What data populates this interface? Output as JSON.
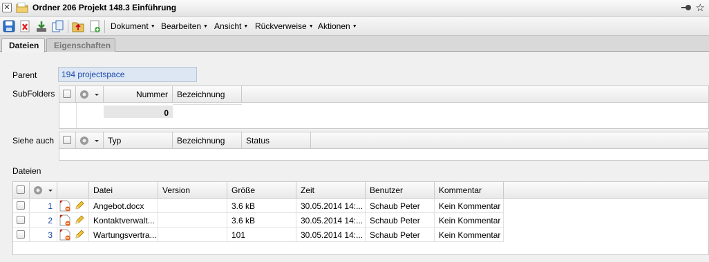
{
  "window": {
    "title": "Ordner 206 Projekt 148.3 Einführung"
  },
  "toolbar": {
    "menus": [
      "Dokument",
      "Bearbeiten",
      "Ansicht",
      "Rückverweise",
      "Aktionen"
    ]
  },
  "tabs": [
    {
      "label": "Dateien",
      "active": true
    },
    {
      "label": "Eigenschaften",
      "active": false
    }
  ],
  "parent": {
    "label": "Parent",
    "value": "194 projectspace"
  },
  "subfolders": {
    "label": "SubFolders",
    "columns": [
      "Nummer",
      "Bezeichnung"
    ],
    "sum": "0"
  },
  "siehe_auch": {
    "label": "Siehe auch",
    "columns": [
      "Typ",
      "Bezeichnung",
      "Status"
    ]
  },
  "dateien": {
    "label": "Dateien",
    "columns": [
      "Datei",
      "Version",
      "Größe",
      "Zeit",
      "Benutzer",
      "Kommentar"
    ],
    "rows": [
      {
        "nr": "1",
        "datei": "Angebot.docx",
        "version": "",
        "groesse": "3.6 kB",
        "zeit": "30.05.2014 14:...",
        "benutzer": "Schaub Peter",
        "kommentar": "Kein Kommentar"
      },
      {
        "nr": "2",
        "datei": "Kontaktverwalt...",
        "version": "",
        "groesse": "3.6 kB",
        "zeit": "30.05.2014 14:...",
        "benutzer": "Schaub Peter",
        "kommentar": "Kein Kommentar"
      },
      {
        "nr": "3",
        "datei": "Wartungsvertra...",
        "version": "",
        "groesse": "101",
        "zeit": "30.05.2014 14:...",
        "benutzer": "Schaub Peter",
        "kommentar": "Kein Kommentar"
      }
    ]
  },
  "icons": [
    "close-icon",
    "folder-icon",
    "pin-icon",
    "star-icon",
    "save-icon",
    "delete-icon",
    "download-icon",
    "copy-icon",
    "upload-icon",
    "new-document-icon",
    "gear-icon",
    "document-icon",
    "edit-icon"
  ]
}
